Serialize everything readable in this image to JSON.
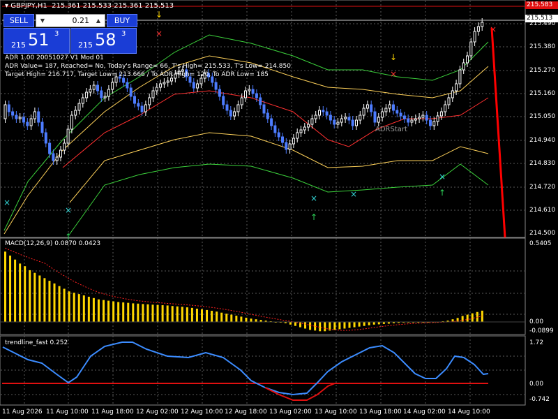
{
  "header": {
    "symbol": "GBPJPY,H1",
    "ohlc": "215.361 215.533 215.361 215.513"
  },
  "trade_panel": {
    "sell_label": "SELL",
    "buy_label": "BUY",
    "lot": "0.21",
    "sell_prefix": "215",
    "sell_big": "51",
    "sell_sup": "3",
    "buy_prefix": "215",
    "buy_big": "58",
    "buy_sup": "3"
  },
  "info": {
    "line1": "ADR 1.00 20051027 V1 Mod 01",
    "line2": "ADR Value= 187, Reached= No, Today's Range= 66, T's High= 215.533, T's Low= 214.850",
    "line3": "Target High= 216.717, Target Low= 213.666 / To ADR High= 120, To ADR Low= 185",
    "adr_start": "ADRStart"
  },
  "price_axis": {
    "labels": [
      "215.490",
      "215.380",
      "215.270",
      "215.160",
      "215.050",
      "214.940",
      "214.830",
      "214.720",
      "214.610",
      "214.500"
    ],
    "tag_red": "215.583",
    "tag_white": "215.513"
  },
  "macd": {
    "label": "MACD(12,26,9) 0.0870 0.0423",
    "axis": [
      "0.5405",
      "0.00",
      "-0.0899"
    ],
    "histogram": [
      0.53,
      0.5,
      0.47,
      0.44,
      0.42,
      0.39,
      0.37,
      0.35,
      0.33,
      0.31,
      0.29,
      0.27,
      0.25,
      0.23,
      0.22,
      0.21,
      0.2,
      0.19,
      0.18,
      0.17,
      0.165,
      0.16,
      0.155,
      0.15,
      0.147,
      0.144,
      0.14,
      0.138,
      0.135,
      0.133,
      0.13,
      0.128,
      0.126,
      0.124,
      0.12,
      0.117,
      0.114,
      0.11,
      0.106,
      0.1,
      0.095,
      0.09,
      0.084,
      0.078,
      0.07,
      0.062,
      0.055,
      0.047,
      0.04,
      0.032,
      0.025,
      0.02,
      0.015,
      0.01,
      0.005,
      0.0,
      -0.005,
      -0.01,
      -0.02,
      -0.03,
      -0.04,
      -0.05,
      -0.06,
      -0.065,
      -0.07,
      -0.07,
      -0.065,
      -0.06,
      -0.055,
      -0.05,
      -0.045,
      -0.04,
      -0.035,
      -0.03,
      -0.025,
      -0.02,
      -0.018,
      -0.015,
      -0.013,
      -0.01,
      -0.008,
      -0.006,
      -0.005,
      -0.004,
      -0.003,
      -0.002,
      -0.002,
      -0.001,
      0.0,
      0.005,
      0.01,
      0.02,
      0.03,
      0.045,
      0.055,
      0.065,
      0.075,
      0.085
    ],
    "signal_color": "#ff2020",
    "bar_color": "#ffd700"
  },
  "trendline": {
    "label": "trendline_fast 0.252",
    "axis": [
      "1.72",
      "0.00",
      "-0.742"
    ]
  },
  "time_axis": [
    "11 Aug 2026",
    "11 Aug 10:00",
    "11 Aug 18:00",
    "12 Aug 02:00",
    "12 Aug 10:00",
    "12 Aug 18:00",
    "13 Aug 02:00",
    "13 Aug 10:00",
    "13 Aug 18:00",
    "14 Aug 02:00",
    "14 Aug 10:00"
  ],
  "colors": {
    "bull": "#ffffff",
    "bear": "#4d7cff",
    "envelope_outer": "#3cd23c",
    "envelope_mid": "#ffd25a",
    "envelope_red": "#ff3030",
    "trend_line": "#3c8cff"
  }
}
